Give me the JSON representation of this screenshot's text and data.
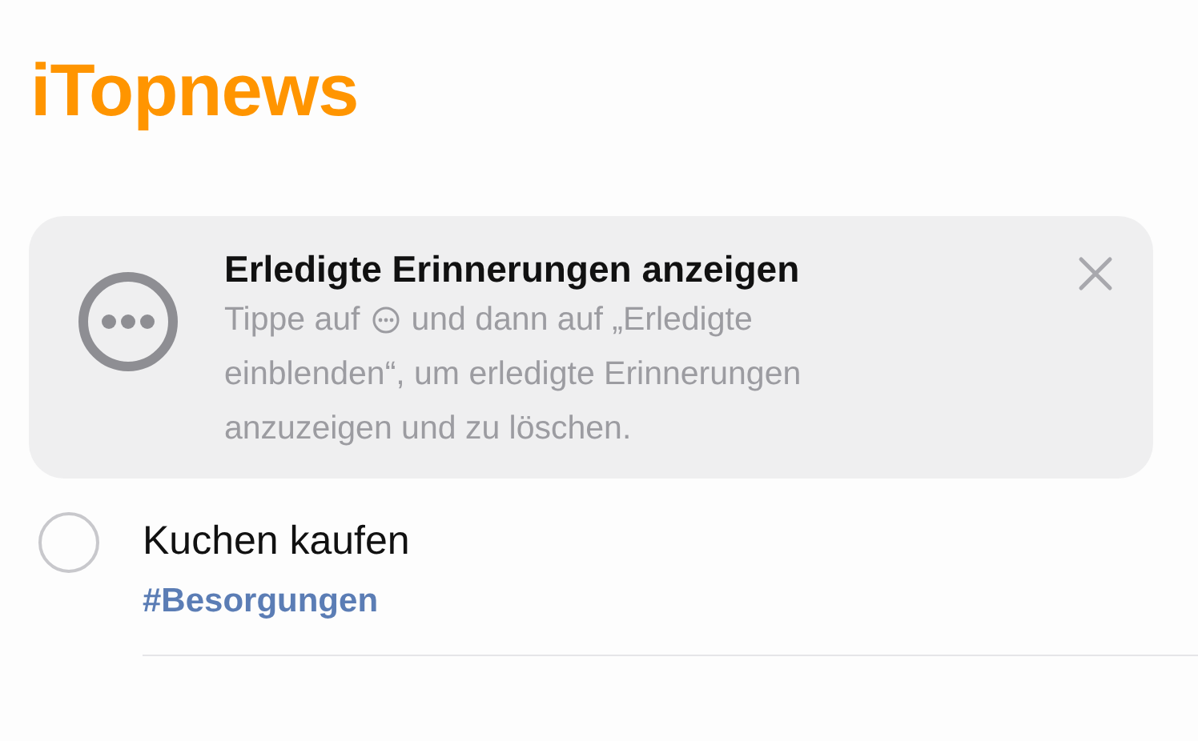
{
  "list_title": "iTopnews",
  "tip": {
    "title": "Erledigte Erinnerungen anzeigen",
    "text_before_icon": "Tippe auf",
    "text_after_icon": "und dann auf „Erledigte",
    "more_lines": [
      "einblenden“, um erledigte Erinnerungen",
      "anzuzeigen und zu löschen."
    ]
  },
  "reminders": [
    {
      "title": "Kuchen kaufen",
      "tag": "#Besorgungen",
      "checked": false
    }
  ]
}
